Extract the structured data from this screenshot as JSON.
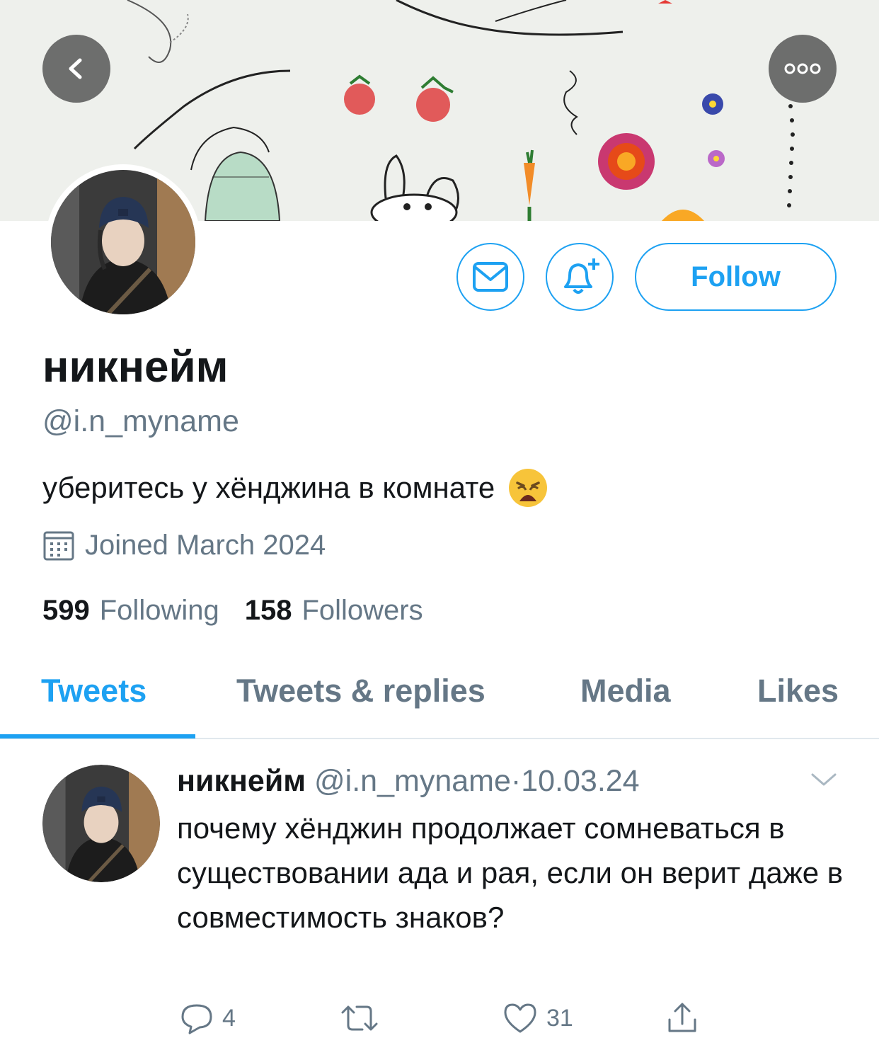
{
  "profile": {
    "display_name": "никнейм",
    "handle": "@i.n_myname",
    "bio": "уберитесь у хёнджина в комнате",
    "joined": "Joined March 2024",
    "following_count": "599",
    "following_label": "Following",
    "followers_count": "158",
    "followers_label": "Followers"
  },
  "actions": {
    "follow_label": "Follow"
  },
  "tabs": [
    {
      "label": "Tweets",
      "active": true
    },
    {
      "label": "Tweets & replies",
      "active": false
    },
    {
      "label": "Media",
      "active": false
    },
    {
      "label": "Likes",
      "active": false
    }
  ],
  "tweet": {
    "name": "никнейм",
    "handle": "@i.n_myname",
    "separator": "·",
    "date": "10.03.24",
    "text": "почему хёнджин продолжает сомневаться в существовании ада и рая, если он верит даже в совместимость знаков?",
    "replies": "4",
    "retweets": "",
    "likes": "31"
  },
  "colors": {
    "accent": "#1da1f2",
    "muted": "#657786",
    "text": "#14171a",
    "divider": "#e1e8ed"
  },
  "icons": [
    "back-arrow-icon",
    "more-icon",
    "mail-icon",
    "bell-plus-icon",
    "calendar-icon",
    "weary-face-emoji",
    "chevron-down-icon",
    "reply-icon",
    "retweet-icon",
    "like-icon",
    "share-icon"
  ]
}
